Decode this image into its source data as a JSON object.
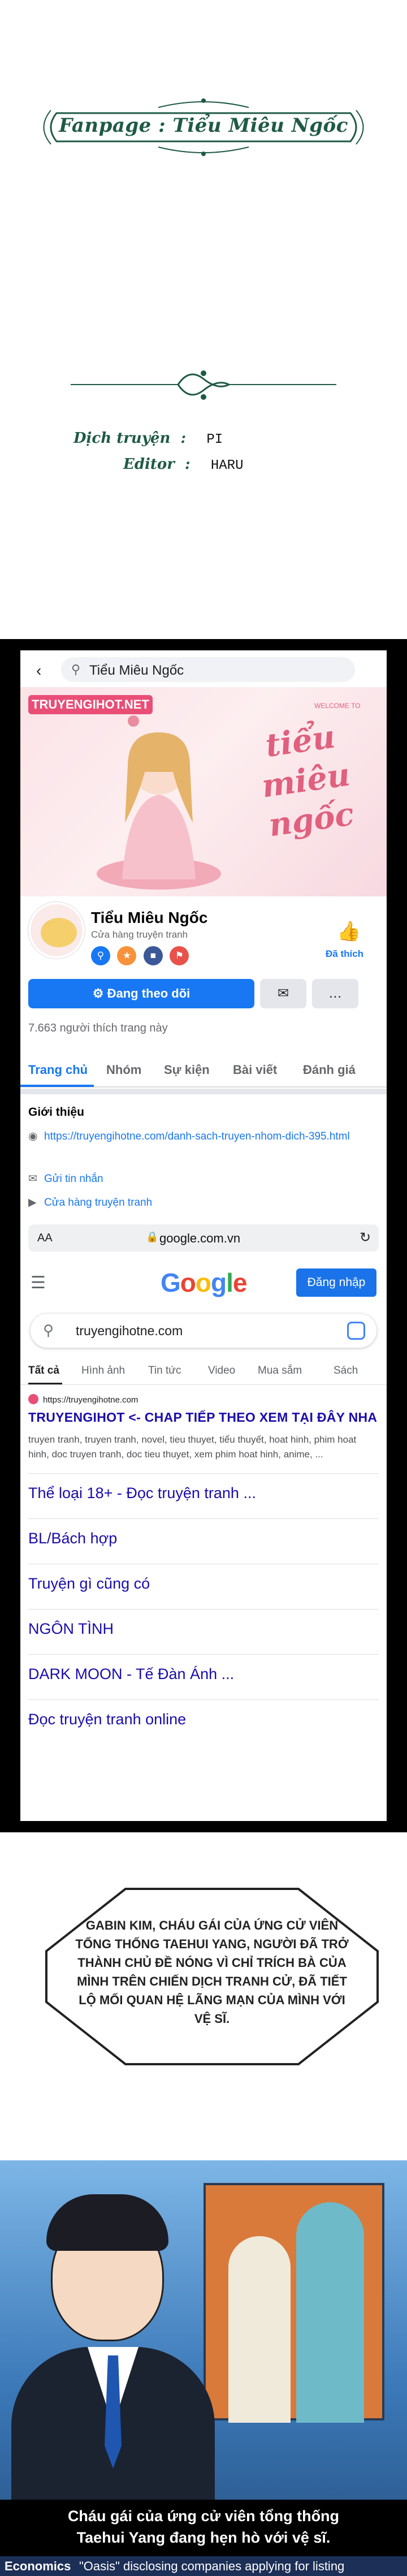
{
  "credits": {
    "fanpage": "Fanpage : Tiểu Miêu Ngốc",
    "translator_label": "Dịch truyện",
    "translator_value": "PI",
    "editor_label": "Editor",
    "editor_value": "HARU"
  },
  "facebook": {
    "search_query": "Tiểu Miêu Ngốc",
    "cover_logo": "TRUYENGIHOT.NET",
    "cover_title": "tiểu miêu ngốc",
    "cover_welcome": "WELCOME TO",
    "page_name": "Tiểu Miêu Ngốc",
    "page_category": "Cửa hàng truyện tranh",
    "liked_label": "Đã thích",
    "follow_button": "Đang theo dõi",
    "likes_count": "7.663 người thích trang này",
    "tabs": [
      "Trang chủ",
      "Nhóm",
      "Sự kiện",
      "Bài viết",
      "Đánh giá"
    ],
    "intro_heading": "Giới thiệu",
    "intro_link": "https://truyengihotne.com/danh-sach-truyen-nhom-dich-395.html",
    "intro_message": "Gửi tin nhắn",
    "intro_category": "Cửa hàng truyện tranh",
    "accent": "#1877f2"
  },
  "browser": {
    "aa_label": "AA",
    "host": "google.com.vn"
  },
  "google": {
    "logo": "Google",
    "sign_in": "Đăng nhập",
    "query": "truyengihotne.com",
    "tabs": [
      "Tất cả",
      "Hình ảnh",
      "Tin tức",
      "Video",
      "Mua sắm",
      "Sách"
    ],
    "result_site": "https://truyengihotne.com",
    "result_title": "TRUYENGIHOT <- CHAP TIẾP THEO XEM TẠI ĐÂY NHA",
    "result_desc": "truyen tranh, truyen tranh, novel, tieu thuyet, tiểu thuyết, hoat hinh, phim hoat hinh, doc truyen tranh, doc tieu thuyet, xem phim hoat hinh, anime, ...",
    "sitelinks": [
      "Thể loại 18+ - Đọc truyện tranh ...",
      "BL/Bách hợp",
      "Truyện gì cũng có",
      "NGÔN TÌNH",
      "DARK MOON - Tế Đàn Ánh ...",
      "Đọc truyện tranh online"
    ]
  },
  "manga": {
    "bubble": "GABIN KIM, CHÁU GÁI CỦA ỨNG CỬ VIÊN TỔNG THỐNG TAEHUI YANG, NGƯỜI ĐÃ TRỞ THÀNH CHỦ ĐỀ NÓNG VÌ CHỈ TRÍCH BÀ CỦA MÌNH TRÊN CHIẾN DỊCH TRANH CỬ, ĐÃ TIẾT LỘ MỐI QUAN HỆ LÃNG MẠN CỦA MÌNH VỚI VỆ SĨ.",
    "caption_line1": "Cháu gái của ứng cử viên tổng thống",
    "caption_line2": "Taehui Yang đang hẹn hò với vệ sĩ.",
    "ticker_label": "Economics",
    "ticker_text": "\"Oasis\" disclosing companies applying for listing"
  }
}
